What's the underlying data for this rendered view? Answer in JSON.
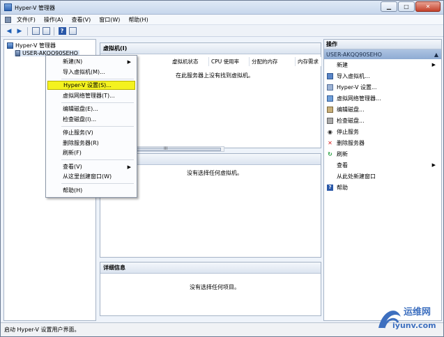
{
  "window": {
    "title": "Hyper-V 管理器"
  },
  "menubar": {
    "items": [
      "文件(F)",
      "操作(A)",
      "查看(V)",
      "窗口(W)",
      "帮助(H)"
    ]
  },
  "tree": {
    "root": "Hyper-V 管理器",
    "server": "USER-AKQQ90SEHO"
  },
  "center": {
    "vm_title": "虚拟机(I)",
    "columns": [
      "虚拟机状态",
      "CPU 使用率",
      "分配的内存",
      "内存需求"
    ],
    "vm_empty": "在此服务器上没有找到虚拟机。",
    "scroll_grip": "III",
    "snap_empty": "没有选择任何虚拟机。",
    "detail_title": "详细信息",
    "detail_empty": "没有选择任何项目。"
  },
  "actions": {
    "title": "操作",
    "server": "USER-AKQQ90SEHO",
    "items": [
      "新建",
      "导入虚拟机...",
      "Hyper-V 设置...",
      "虚拟网络管理器...",
      "编辑磁盘...",
      "检查磁盘...",
      "停止服务",
      "删除服务器",
      "刷新",
      "查看",
      "从此处新建窗口",
      "帮助"
    ]
  },
  "context_menu": {
    "new": "新建(N)",
    "import": "导入虚拟机(M)...",
    "hyperv_settings": "Hyper-V 设置(S)...",
    "vnet_manager": "虚拟网络管理器(T)...",
    "edit_disk": "编辑磁盘(E)...",
    "inspect_disk": "检查磁盘(I)...",
    "stop_service": "停止服务(V)",
    "remove_server": "删除服务器(R)",
    "refresh": "刷新(F)",
    "view": "查看(V)",
    "new_window": "从这里创建窗口(W)",
    "help": "帮助(H)"
  },
  "statusbar": {
    "text": "启动 Hyper-V 设置用户界面。"
  },
  "watermark": {
    "line1": "运维网",
    "line2": "iyunv.com"
  },
  "colors": {
    "highlight": "#f4f21f",
    "accent": "#2e64b4",
    "actions_header": "#8eabd3"
  }
}
